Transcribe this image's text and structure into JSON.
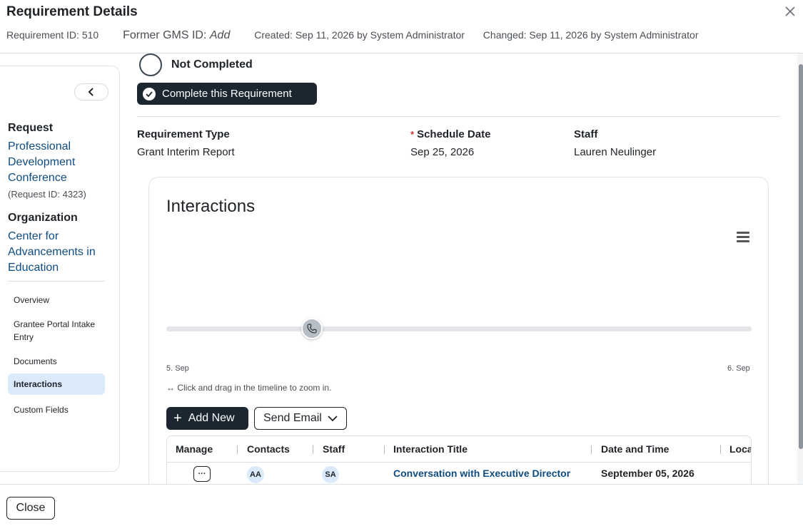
{
  "header": {
    "title": "Requirement Details",
    "requirement_id": "Requirement ID: 510",
    "former_gms_label": "Former GMS ID:",
    "former_gms_value": "Add",
    "created": "Created: Sep 11, 2026 by System Administrator",
    "changed": "Changed: Sep 11, 2026 by System Administrator"
  },
  "sidebar": {
    "request_label": "Request",
    "request_name": "Professional Development Conference",
    "request_id": "(Request ID: 4323)",
    "organization_label": "Organization",
    "organization_name": "Center for Advancements in Education",
    "nav": [
      {
        "label": "Overview"
      },
      {
        "label": "Grantee Portal Intake Entry"
      },
      {
        "label": "Documents"
      },
      {
        "label": "Interactions"
      },
      {
        "label": "Custom Fields"
      }
    ]
  },
  "status": {
    "text": "Not Completed",
    "complete_button": "Complete this Requirement"
  },
  "fields": {
    "requirement_type_label": "Requirement Type",
    "requirement_type_value": "Grant Interim Report",
    "schedule_date_label": "Schedule Date",
    "schedule_date_required": "*",
    "schedule_date_value": "Sep 25, 2026",
    "staff_label": "Staff",
    "staff_value": "Lauren Neulinger"
  },
  "interactions": {
    "title": "Interactions",
    "timeline_ticks": [
      "5. Sep",
      "6. Sep"
    ],
    "zoom_hint": "↔ Click and drag in the timeline to zoom in.",
    "add_button": "Add New",
    "email_button": "Send Email",
    "table": {
      "columns": [
        "Manage",
        "Contacts",
        "Staff",
        "Interaction Title",
        "Date and Time",
        "Loca"
      ],
      "rows": [
        {
          "manage": "···",
          "contact": "AA",
          "staff": "SA",
          "title": "Conversation with Executive Director",
          "date": "September 05, 2026"
        }
      ]
    }
  },
  "footer": {
    "close_button": "Close"
  },
  "colors": {
    "primary_dark": "#1b2631",
    "link": "#0f4c81",
    "active_nav": "#dbeafb",
    "required": "#c0392b"
  }
}
